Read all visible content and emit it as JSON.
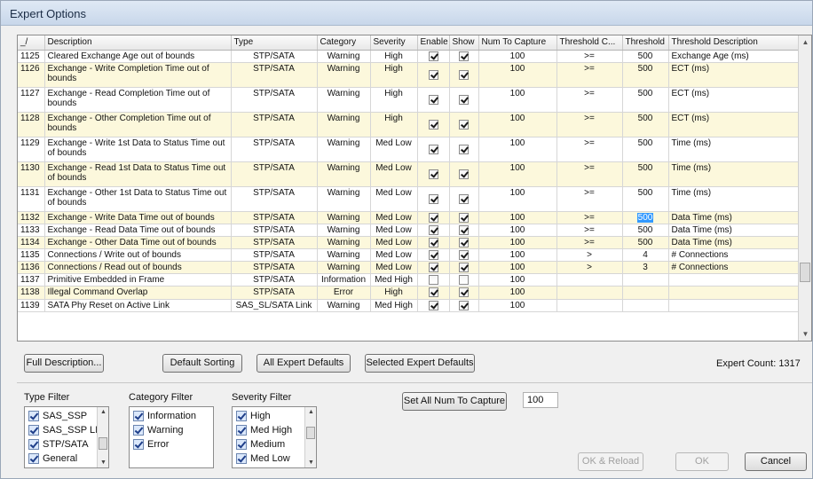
{
  "window": {
    "title": "Expert Options"
  },
  "columns": [
    "_/",
    "Description",
    "Type",
    "Category",
    "Severity",
    "Enable",
    "Show",
    "Num To Capture",
    "Threshold C...",
    "Threshold",
    "Threshold Description"
  ],
  "rows": [
    {
      "id": "1125",
      "desc": "Cleared Exchange Age out of bounds",
      "type": "STP/SATA",
      "category": "Warning",
      "severity": "High",
      "enable": true,
      "show": true,
      "num": "100",
      "cmp": ">=",
      "threshold": "500",
      "tdesc": "Exchange Age (ms)"
    },
    {
      "id": "1126",
      "desc": "Exchange - Write Completion Time out of bounds",
      "type": "STP/SATA",
      "category": "Warning",
      "severity": "High",
      "enable": true,
      "show": true,
      "num": "100",
      "cmp": ">=",
      "threshold": "500",
      "tdesc": "ECT (ms)"
    },
    {
      "id": "1127",
      "desc": "Exchange - Read Completion Time out of bounds",
      "type": "STP/SATA",
      "category": "Warning",
      "severity": "High",
      "enable": true,
      "show": true,
      "num": "100",
      "cmp": ">=",
      "threshold": "500",
      "tdesc": "ECT (ms)"
    },
    {
      "id": "1128",
      "desc": "Exchange - Other Completion Time out of bounds",
      "type": "STP/SATA",
      "category": "Warning",
      "severity": "High",
      "enable": true,
      "show": true,
      "num": "100",
      "cmp": ">=",
      "threshold": "500",
      "tdesc": "ECT (ms)"
    },
    {
      "id": "1129",
      "desc": "Exchange - Write 1st Data to Status Time out of bounds",
      "type": "STP/SATA",
      "category": "Warning",
      "severity": "Med Low",
      "enable": true,
      "show": true,
      "num": "100",
      "cmp": ">=",
      "threshold": "500",
      "tdesc": "Time (ms)"
    },
    {
      "id": "1130",
      "desc": "Exchange - Read 1st Data to Status Time out of bounds",
      "type": "STP/SATA",
      "category": "Warning",
      "severity": "Med Low",
      "enable": true,
      "show": true,
      "num": "100",
      "cmp": ">=",
      "threshold": "500",
      "tdesc": "Time (ms)"
    },
    {
      "id": "1131",
      "desc": "Exchange - Other 1st Data to Status Time out of bounds",
      "type": "STP/SATA",
      "category": "Warning",
      "severity": "Med Low",
      "enable": true,
      "show": true,
      "num": "100",
      "cmp": ">=",
      "threshold": "500",
      "tdesc": "Time (ms)"
    },
    {
      "id": "1132",
      "desc": "Exchange - Write Data Time out of bounds",
      "type": "STP/SATA",
      "category": "Warning",
      "severity": "Med Low",
      "enable": true,
      "show": true,
      "num": "100",
      "cmp": ">=",
      "threshold": "500",
      "tdesc": "Data Time (ms)"
    },
    {
      "id": "1133",
      "desc": "Exchange - Read Data Time out of bounds",
      "type": "STP/SATA",
      "category": "Warning",
      "severity": "Med Low",
      "enable": true,
      "show": true,
      "num": "100",
      "cmp": ">=",
      "threshold": "500",
      "tdesc": "Data Time (ms)"
    },
    {
      "id": "1134",
      "desc": "Exchange - Other Data Time out of bounds",
      "type": "STP/SATA",
      "category": "Warning",
      "severity": "Med Low",
      "enable": true,
      "show": true,
      "num": "100",
      "cmp": ">=",
      "threshold": "500",
      "tdesc": "Data Time (ms)"
    },
    {
      "id": "1135",
      "desc": "Connections / Write out of bounds",
      "type": "STP/SATA",
      "category": "Warning",
      "severity": "Med Low",
      "enable": true,
      "show": true,
      "num": "100",
      "cmp": ">",
      "threshold": "4",
      "tdesc": "# Connections"
    },
    {
      "id": "1136",
      "desc": "Connections / Read out of bounds",
      "type": "STP/SATA",
      "category": "Warning",
      "severity": "Med Low",
      "enable": true,
      "show": true,
      "num": "100",
      "cmp": ">",
      "threshold": "3",
      "tdesc": "# Connections"
    },
    {
      "id": "1137",
      "desc": "Primitive Embedded in Frame",
      "type": "STP/SATA",
      "category": "Information",
      "severity": "Med High",
      "enable": false,
      "show": false,
      "num": "100",
      "cmp": "",
      "threshold": "",
      "tdesc": ""
    },
    {
      "id": "1138",
      "desc": "Illegal Command Overlap",
      "type": "STP/SATA",
      "category": "Error",
      "severity": "High",
      "enable": true,
      "show": true,
      "num": "100",
      "cmp": "",
      "threshold": "",
      "tdesc": ""
    },
    {
      "id": "1139",
      "desc": "SATA Phy Reset on Active Link",
      "type": "SAS_SL/SATA Link",
      "category": "Warning",
      "severity": "Med High",
      "enable": true,
      "show": true,
      "num": "100",
      "cmp": "",
      "threshold": "",
      "tdesc": ""
    }
  ],
  "buttons": {
    "full_description": "Full Description...",
    "default_sorting": "Default Sorting",
    "all_expert_defaults": "All Expert Defaults",
    "selected_expert_defaults": "Selected Expert Defaults",
    "set_all_num": "Set All Num To Capture",
    "ok_reload": "OK & Reload",
    "ok": "OK",
    "cancel": "Cancel"
  },
  "expert_count": "Expert Count: 1317",
  "num_to_capture_value": "100",
  "filters": {
    "type": {
      "label": "Type Filter",
      "items": [
        "SAS_SSP",
        "SAS_SSP LI",
        "STP/SATA",
        "General"
      ]
    },
    "category": {
      "label": "Category Filter",
      "items": [
        "Information",
        "Warning",
        "Error"
      ]
    },
    "severity": {
      "label": "Severity Filter",
      "items": [
        "High",
        "Med High",
        "Medium",
        "Med Low"
      ]
    }
  }
}
